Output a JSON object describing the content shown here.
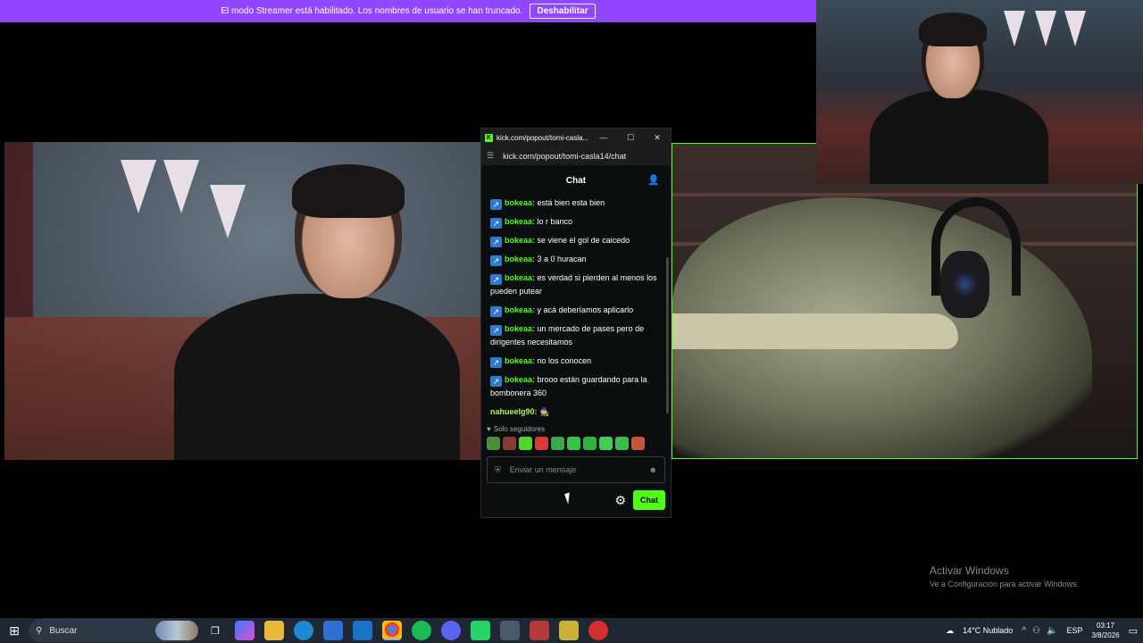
{
  "banner": {
    "message": "El modo Streamer está habilitado. Los nombres de usuario se han truncado.",
    "button": "Deshabilitar"
  },
  "popout": {
    "window_title": "kick.com/popout/tomi-casla...",
    "url": "kick.com/popout/tomi-casla14/chat",
    "header": "Chat",
    "messages": [
      {
        "user": "bokeaa:",
        "text": "está bien esta bien"
      },
      {
        "user": "bokeaa:",
        "text": "lo r banco"
      },
      {
        "user": "bokeaa:",
        "text": "se viene el gol de caicedo"
      },
      {
        "user": "bokeaa:",
        "text": "3 a 0 huracan"
      },
      {
        "user": "bokeaa:",
        "text": "es verdad si pierden al menos los pueden putear"
      },
      {
        "user": "bokeaa:",
        "text": "y acá deberíamos aplicarlo"
      },
      {
        "user": "bokeaa:",
        "text": "un mercado de pases pero de dirigentes necesitamos"
      },
      {
        "user": "bokeaa:",
        "text": "no los conocen"
      },
      {
        "user": "bokeaa:",
        "text": "brooo están guardando para la bombonera 360"
      },
      {
        "user": "nahueelg90:",
        "text": ""
      }
    ],
    "followers_only": "Solo seguidores",
    "input_placeholder": "Enviar un mensaje",
    "send_button": "Chat"
  },
  "watermark": {
    "title": "Activar Windows",
    "subtitle": "Ve a Configuración para activar Windows."
  },
  "taskbar": {
    "search_label": "Buscar",
    "weather": "14°C  Nublado",
    "language": "ESP",
    "time": "03:17",
    "date": "3/8/2026"
  },
  "colors": {
    "banner": "#9147ff",
    "kick_green": "#53fc18",
    "taskbar": "#1f2733"
  }
}
